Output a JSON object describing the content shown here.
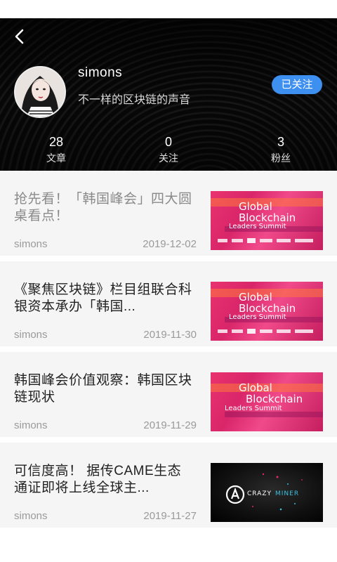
{
  "profile": {
    "username": "simons",
    "tagline": "不一样的区块链的声音",
    "follow_label": "已关注",
    "stats": [
      {
        "value": "28",
        "label": "文章"
      },
      {
        "value": "0",
        "label": "关注"
      },
      {
        "value": "3",
        "label": "粉丝"
      }
    ]
  },
  "articles": [
    {
      "title": "抢先看！「韩国峰会」四大圆桌看点！",
      "author": "simons",
      "date": "2019-12-02",
      "thumb_line1": "Global",
      "thumb_line2": "Blockchain",
      "thumb_line3": "Leaders Summit"
    },
    {
      "title": "《聚焦区块链》栏目组联合科银资本承办「韩国...",
      "author": "simons",
      "date": "2019-11-30",
      "thumb_line1": "Global",
      "thumb_line2": "Blockchain",
      "thumb_line3": "Leaders Summit"
    },
    {
      "title": "韩国峰会价值观察：韩国区块链现状",
      "author": "simons",
      "date": "2019-11-29",
      "thumb_line1": "Global",
      "thumb_line2": "Blockchain",
      "thumb_line3": "Leaders Summit"
    },
    {
      "title": "可信度高！ 据传CAME生态通证即将上线全球主...",
      "author": "simons",
      "date": "2019-11-27",
      "thumb_line1": "CRAZY",
      "thumb_line2": "MINER"
    }
  ],
  "colors": {
    "accent": "#3d8ff0",
    "header_bg": "#0b0b0b",
    "read_title": "#8a8a8a"
  }
}
